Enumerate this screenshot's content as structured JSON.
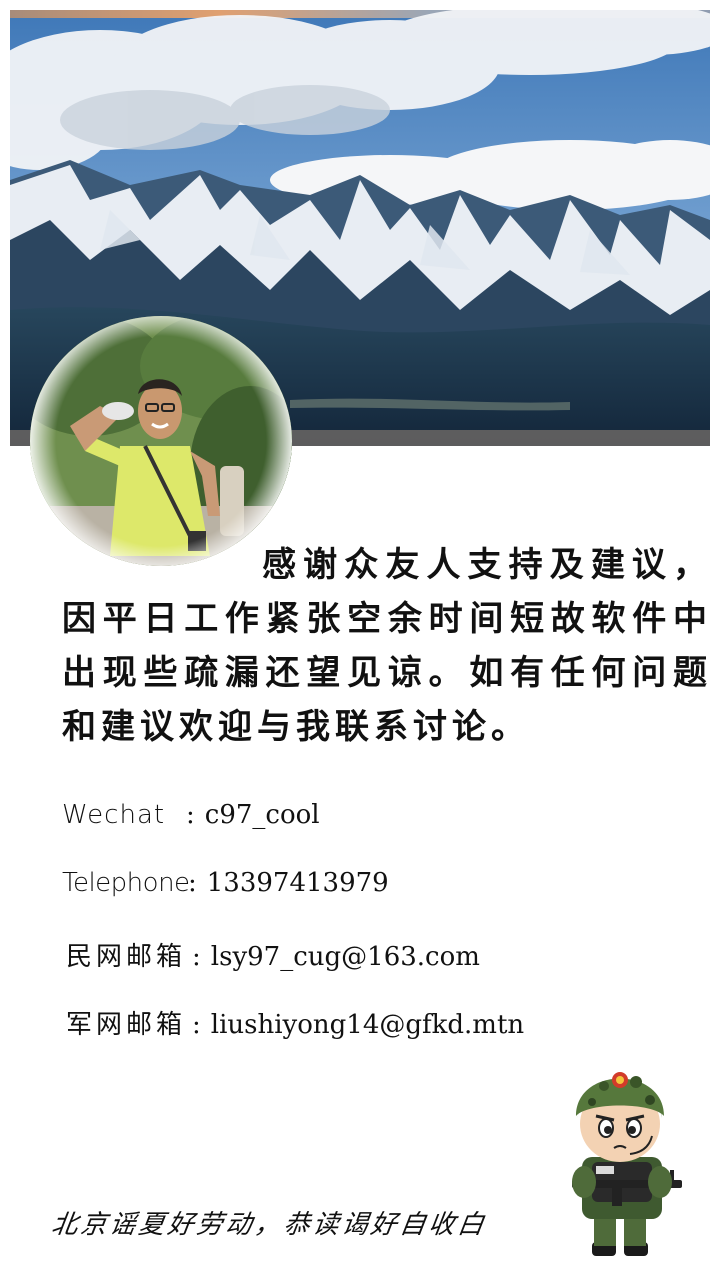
{
  "message": {
    "text": "感谢众友人支持及建议，因平日工作紧张空余时间短故软件中出现些疏漏还望见谅。如有任何问题和建议欢迎与我联系讨论。"
  },
  "contacts": [
    {
      "label": "Wechat",
      "sep": ":",
      "value": "c97_cool"
    },
    {
      "label": "Telephone",
      "sep": ":",
      "value": "13397413979"
    },
    {
      "label": "民网邮箱",
      "sep": ":",
      "value": "lsy97_cug@163.com"
    },
    {
      "label": "军网邮箱",
      "sep": ":",
      "value": "liushiyong14@gfkd.mtn"
    }
  ],
  "footer": {
    "signature": "北京谣夏好劳动，恭读谒好自收白"
  },
  "images": {
    "banner": "mountain-landscape",
    "avatar": "person-saluting-photo",
    "mascot": "police-cartoon-mascot"
  },
  "colors": {
    "sky": "#5b8fc7",
    "mountain_dark": "#1f3b52",
    "text": "#111111"
  }
}
